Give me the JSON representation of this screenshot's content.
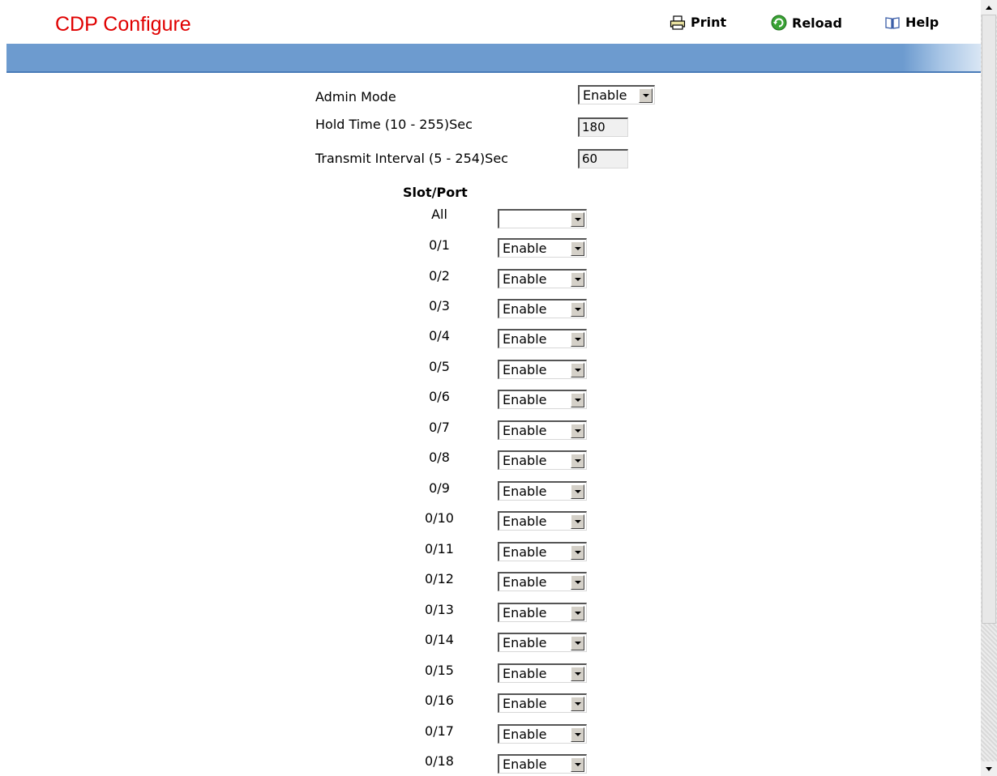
{
  "header": {
    "title": "CDP Configure",
    "print_label": "Print",
    "reload_label": "Reload",
    "help_label": "Help"
  },
  "form": {
    "admin_mode_label": "Admin Mode",
    "admin_mode_value": "Enable",
    "hold_time_label": "Hold Time (10 - 255)Sec",
    "hold_time_value": "180",
    "transmit_interval_label": "Transmit Interval (5 - 254)Sec",
    "transmit_interval_value": "60"
  },
  "ports": {
    "header": "Slot/Port",
    "rows": [
      {
        "port": "All",
        "value": ""
      },
      {
        "port": "0/1",
        "value": "Enable"
      },
      {
        "port": "0/2",
        "value": "Enable"
      },
      {
        "port": "0/3",
        "value": "Enable"
      },
      {
        "port": "0/4",
        "value": "Enable"
      },
      {
        "port": "0/5",
        "value": "Enable"
      },
      {
        "port": "0/6",
        "value": "Enable"
      },
      {
        "port": "0/7",
        "value": "Enable"
      },
      {
        "port": "0/8",
        "value": "Enable"
      },
      {
        "port": "0/9",
        "value": "Enable"
      },
      {
        "port": "0/10",
        "value": "Enable"
      },
      {
        "port": "0/11",
        "value": "Enable"
      },
      {
        "port": "0/12",
        "value": "Enable"
      },
      {
        "port": "0/13",
        "value": "Enable"
      },
      {
        "port": "0/14",
        "value": "Enable"
      },
      {
        "port": "0/15",
        "value": "Enable"
      },
      {
        "port": "0/16",
        "value": "Enable"
      },
      {
        "port": "0/17",
        "value": "Enable"
      },
      {
        "port": "0/18",
        "value": "Enable"
      }
    ]
  },
  "icons": {
    "print": "printer-icon",
    "reload": "reload-icon",
    "help": "book-icon"
  },
  "colors": {
    "title": "#e00000",
    "header_bar": "#6d9bcf"
  }
}
